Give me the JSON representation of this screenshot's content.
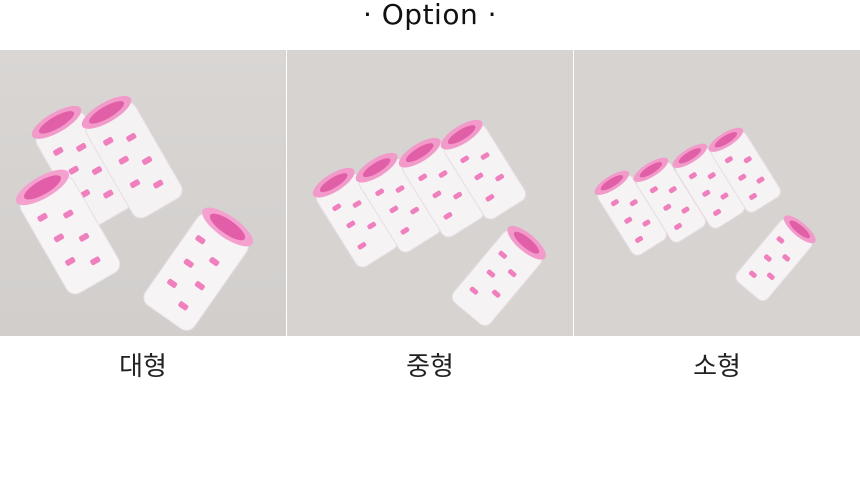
{
  "header": {
    "title": "· Option ·"
  },
  "options": [
    {
      "label": "대형",
      "image": "large-hair-rollers"
    },
    {
      "label": "중형",
      "image": "medium-hair-rollers"
    },
    {
      "label": "소형",
      "image": "small-hair-rollers"
    }
  ],
  "colors": {
    "roller_pink": "#f28bc4",
    "roller_white": "#f6f3f4",
    "background": "#d7d4d2"
  }
}
